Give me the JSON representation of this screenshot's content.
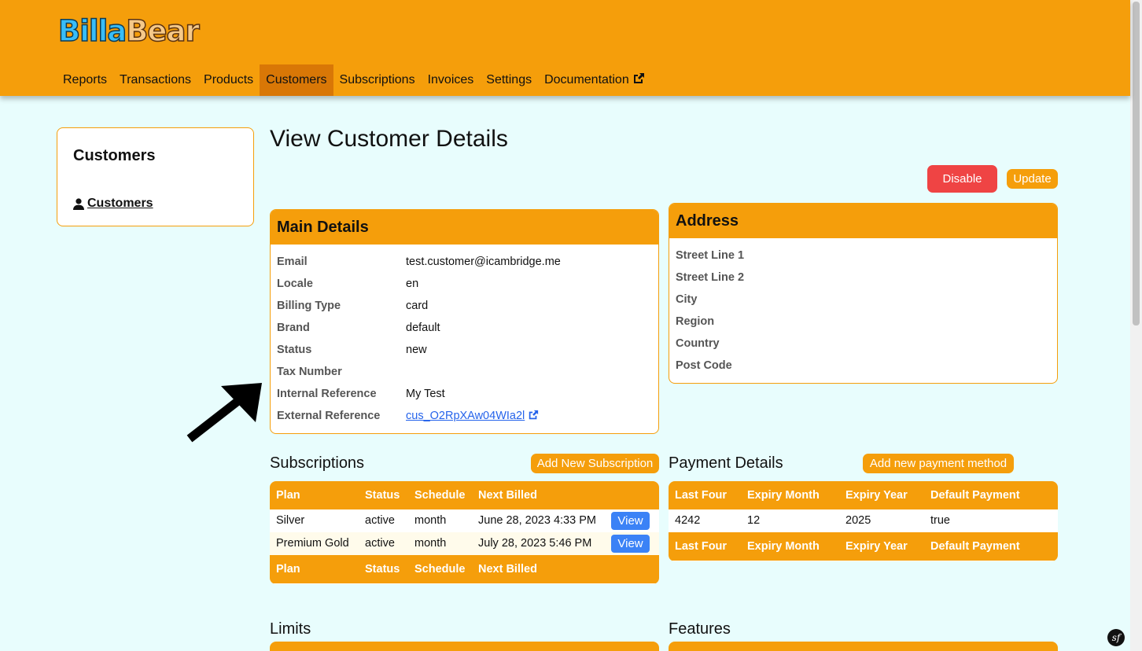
{
  "header": {
    "logo_part1": "Billa",
    "logo_part2": "Bear",
    "nav": [
      "Reports",
      "Transactions",
      "Products",
      "Customers",
      "Subscriptions",
      "Invoices",
      "Settings",
      "Documentation"
    ],
    "active_nav": "Customers",
    "accent_color": "#f59e0b"
  },
  "sidebar": {
    "title": "Customers",
    "link": "Customers",
    "link_icon": "user-icon"
  },
  "page": {
    "title": "View Customer Details",
    "disable_label": "Disable",
    "update_label": "Update"
  },
  "main_details": {
    "title": "Main Details",
    "rows": [
      {
        "label": "Email",
        "value": "test.customer@icambridge.me"
      },
      {
        "label": "Locale",
        "value": "en"
      },
      {
        "label": "Billing Type",
        "value": "card"
      },
      {
        "label": "Brand",
        "value": "default"
      },
      {
        "label": "Status",
        "value": "new"
      },
      {
        "label": "Tax Number",
        "value": ""
      },
      {
        "label": "Internal Reference",
        "value": "My Test"
      },
      {
        "label": "External Reference",
        "value": "cus_O2RpXAw04WIa2l"
      }
    ]
  },
  "address": {
    "title": "Address",
    "rows": [
      "Street Line 1",
      "Street Line 2",
      "City",
      "Region",
      "Country",
      "Post Code"
    ]
  },
  "subscriptions": {
    "title": "Subscriptions",
    "add_label": "Add New Subscription",
    "headers": [
      "Plan",
      "Status",
      "Schedule",
      "Next Billed"
    ],
    "rows": [
      {
        "plan": "Silver",
        "status": "active",
        "schedule": "month",
        "next": "June 28, 2023 4:33 PM",
        "view": "View"
      },
      {
        "plan": "Premium Gold",
        "status": "active",
        "schedule": "month",
        "next": "July 28, 2023 5:46 PM",
        "view": "View"
      }
    ]
  },
  "payment": {
    "title": "Payment Details",
    "add_label": "Add new payment method",
    "headers": [
      "Last Four",
      "Expiry Month",
      "Expiry Year",
      "Default Payment"
    ],
    "rows": [
      {
        "last_four": "4242",
        "month": "12",
        "year": "2025",
        "default": "true"
      }
    ]
  },
  "limits_title": "Limits",
  "features_title": "Features"
}
